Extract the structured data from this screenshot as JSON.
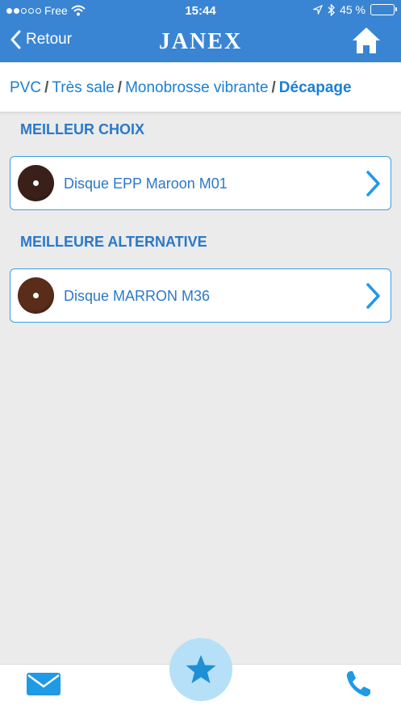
{
  "status_bar": {
    "carrier": "Free",
    "time": "15:44",
    "battery": "45 %",
    "battery_fraction": 0.45
  },
  "nav": {
    "back_label": "Retour",
    "brand": "JANEX",
    "home_icon": "home-icon"
  },
  "breadcrumb": {
    "items": [
      "PVC",
      "Très sale",
      "Monobrosse vibrante"
    ],
    "separator": "/",
    "current": "Décapage"
  },
  "sections": [
    {
      "title": "MEILLEUR CHOIX",
      "item": {
        "label": "Disque EPP Maroon M01",
        "disc_color": "#3a2019"
      }
    },
    {
      "title": "MEILLEURE ALTERNATIVE",
      "item": {
        "label": "Disque MARRON M36",
        "disc_color": "#5a2c1a"
      }
    }
  ],
  "bottom_bar": {
    "left_icon": "mail-icon",
    "center_icon": "star-icon",
    "right_icon": "phone-icon"
  },
  "colors": {
    "header": "#3a85d3",
    "accent": "#2a79c9",
    "card_border": "#3a9fe0",
    "fab": "#b5e0f8",
    "icon_blue": "#1f9ae5"
  }
}
